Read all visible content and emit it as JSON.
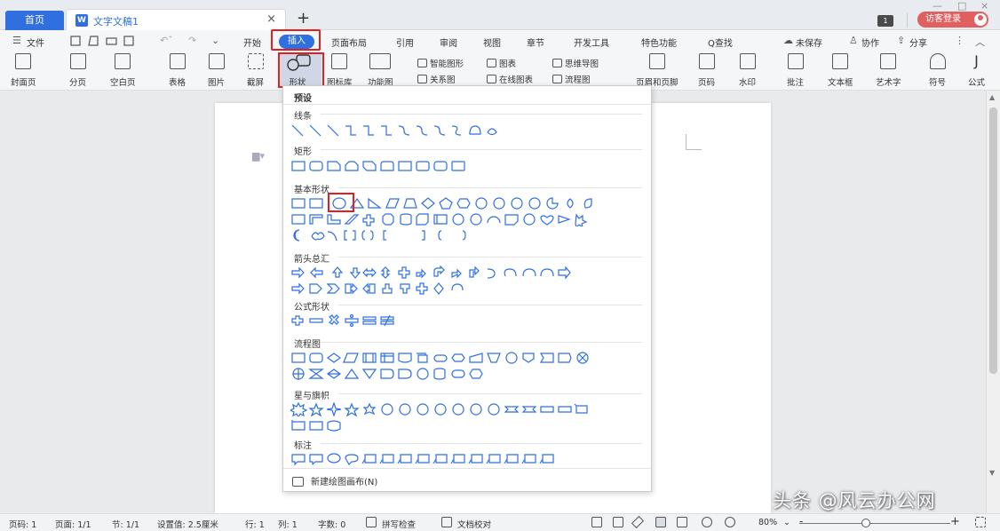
{
  "titlebar": {
    "home_tab": "首页",
    "doc_tab": "文字文稿1",
    "doc_tab_close": "×",
    "add_tab": "+",
    "badge": "1",
    "visitor_login": "访客登录",
    "win_minimize": "—",
    "win_restore": "□",
    "win_close": "×"
  },
  "menubar": {
    "file": "文件",
    "tabs": [
      "开始",
      "插入",
      "页面布局",
      "引用",
      "审阅",
      "视图",
      "章节",
      "开发工具",
      "特色功能"
    ],
    "active_tab": "插入",
    "search": "Q查找",
    "unsaved": "未保存",
    "collaborate": "协作",
    "share": "分享"
  },
  "toolbar": {
    "cover_page": "封面页",
    "page_break": "分页",
    "blank_page": "空白页",
    "table": "表格",
    "picture": "图片",
    "screenshot": "截屏",
    "shape": "形状",
    "icon_library": "图标库",
    "function_chart": "功能图",
    "smart_art": "智能图形",
    "chart": "图表",
    "mind_map": "思维导图",
    "relation_chart": "关系图",
    "online_chart": "在线图表",
    "flowchart": "流程图",
    "header_footer": "页眉和页脚",
    "page_number": "页码",
    "watermark": "水印",
    "comment": "批注",
    "textbox": "文本框",
    "word_art": "艺术字",
    "symbol": "符号",
    "formula": "公式"
  },
  "shapes_panel": {
    "preset": "预设",
    "categories": {
      "lines": "线条",
      "rectangles": "矩形",
      "basic": "基本形状",
      "arrows": "箭头总汇",
      "equation": "公式形状",
      "flowchart": "流程图",
      "stars": "星与旗帜",
      "callouts": "标注"
    },
    "new_canvas": "新建绘图画布(N)",
    "selected_shape": "ellipse"
  },
  "statusbar": {
    "page_code": "页码: 1",
    "pages": "页面: 1/1",
    "section": "节: 1/1",
    "setting": "设置值: 2.5厘米",
    "row": "行: 1",
    "col": "列: 1",
    "word_count": "字数: 0",
    "spell_check": "拼写检查",
    "doc_proof": "文档校对",
    "zoom": "80%",
    "zoom_minus": "-",
    "zoom_plus": "+"
  },
  "watermark": "头条 @风云办公网",
  "colors": {
    "accent": "#2f6fe0",
    "highlight": "#e02020",
    "visitor": "#e06060"
  }
}
